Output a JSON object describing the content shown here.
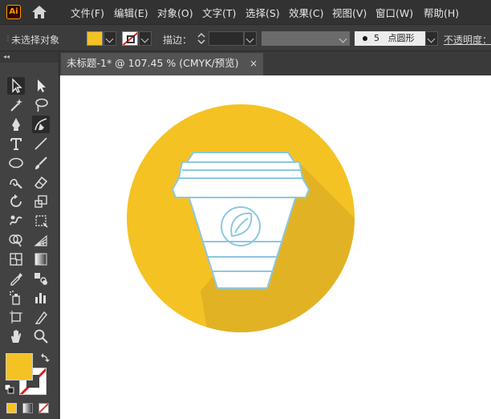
{
  "app": {
    "logo": "Ai"
  },
  "menu": [
    "文件(F)",
    "编辑(E)",
    "对象(O)",
    "文字(T)",
    "选择(S)",
    "效果(C)",
    "视图(V)",
    "窗口(W)",
    "帮助(H)"
  ],
  "control_bar": {
    "selection_status": "未选择对象",
    "stroke_label": "描边：",
    "brush_size": "5",
    "brush_label": "点圆形",
    "opacity_label": "不透明度："
  },
  "document": {
    "tab_title": "未标题-1* @ 107.45 % (CMYK/预览)",
    "close_glyph": "×"
  },
  "colors": {
    "fill": "#f5c224",
    "circle": "#f5c224",
    "shadow": "#e2b225",
    "cup_fill": "#ffffff",
    "cup_stroke": "#8cc8e0",
    "stroke_none_slash": "#e02020"
  },
  "tools": [
    "selection-tool",
    "direct-selection-tool",
    "magic-wand-tool",
    "lasso-tool",
    "pen-tool",
    "curvature-tool",
    "type-tool",
    "line-segment-tool",
    "ellipse-tool",
    "paintbrush-tool",
    "shaper-tool",
    "eraser-tool",
    "rotate-tool",
    "scale-tool",
    "warp-tool",
    "free-transform-tool",
    "shape-builder-tool",
    "perspective-grid-tool",
    "mesh-tool",
    "gradient-tool",
    "eyedropper-tool",
    "blend-tool",
    "symbol-sprayer-tool",
    "column-graph-tool",
    "artboard-tool",
    "slice-tool",
    "hand-tool",
    "zoom-tool"
  ]
}
